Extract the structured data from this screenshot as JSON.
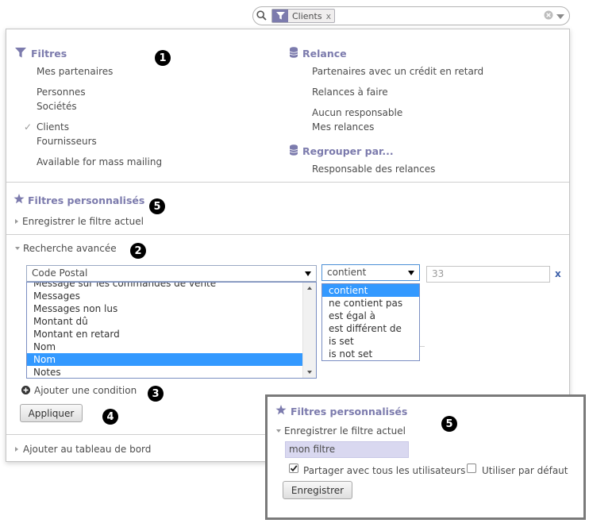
{
  "search": {
    "facet_label": "Clients",
    "facet_remove": "x"
  },
  "filters": {
    "title": "Filtres",
    "items": {
      "mes_partenaires": "Mes partenaires",
      "personnes": "Personnes",
      "societes": "Sociétés",
      "clients": "Clients",
      "fournisseurs": "Fournisseurs",
      "mass_mailing": "Available for mass mailing"
    },
    "checked_mark": "✓"
  },
  "relance": {
    "title": "Relance",
    "items": {
      "credit_retard": "Partenaires avec un crédit en retard",
      "relances_faire": "Relances à faire",
      "aucun_responsable": "Aucun responsable",
      "mes_relances": "Mes relances"
    }
  },
  "groupby": {
    "title": "Regrouper par...",
    "items": {
      "responsable": "Responsable des relances"
    }
  },
  "custom_filters": {
    "title": "Filtres personnalisés",
    "save_current": "Enregistrer le filtre actuel"
  },
  "advanced": {
    "title": "Recherche avancée",
    "field_selected": "Code Postal",
    "field_options": {
      "o0": "Message sur les commandes de vente",
      "o1": "Messages",
      "o2": "Messages non lus",
      "o3": "Montant dû",
      "o4": "Montant en retard",
      "o5": "Nom",
      "o6": "Nom",
      "o7": "Notes"
    },
    "operator_selected": "contient",
    "operator_options": {
      "o0": "contient",
      "o1": "ne contient pas",
      "o2": "est égal à",
      "o3": "est différent de",
      "o4": "is set",
      "o5": "is not set"
    },
    "value": "33",
    "remove": "x",
    "add_condition": "Ajouter une condition",
    "apply": "Appliquer"
  },
  "dashboard": {
    "label": "Ajouter au tableau de bord"
  },
  "badges": {
    "b1": "1",
    "b2": "2",
    "b3": "3",
    "b4": "4",
    "b5": "5"
  },
  "inset": {
    "title": "Filtres personnalisés",
    "save_current": "Enregistrer le filtre actuel",
    "name_value": "mon filtre",
    "share_all": "Partager avec tous les utilisateurs",
    "share_all_checked": true,
    "use_default": "Utiliser par défaut",
    "use_default_checked": false,
    "save_button": "Enregistrer"
  },
  "colors": {
    "accent": "#7c7bad",
    "selection": "#3399ff",
    "link": "#3b5ea8"
  }
}
